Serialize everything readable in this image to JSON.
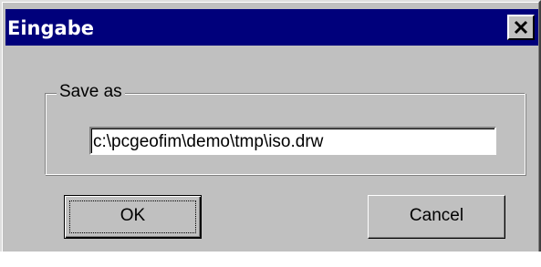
{
  "window": {
    "title": "Eingabe",
    "title_bar_color": "#00007b",
    "face_color": "#c0c0c0",
    "close_icon": "close-icon"
  },
  "save_group": {
    "label": "Save as",
    "path_value": "c:\\pcgeofim\\demo\\tmp\\iso.drw"
  },
  "buttons": {
    "ok_label": "OK",
    "cancel_label": "Cancel"
  }
}
